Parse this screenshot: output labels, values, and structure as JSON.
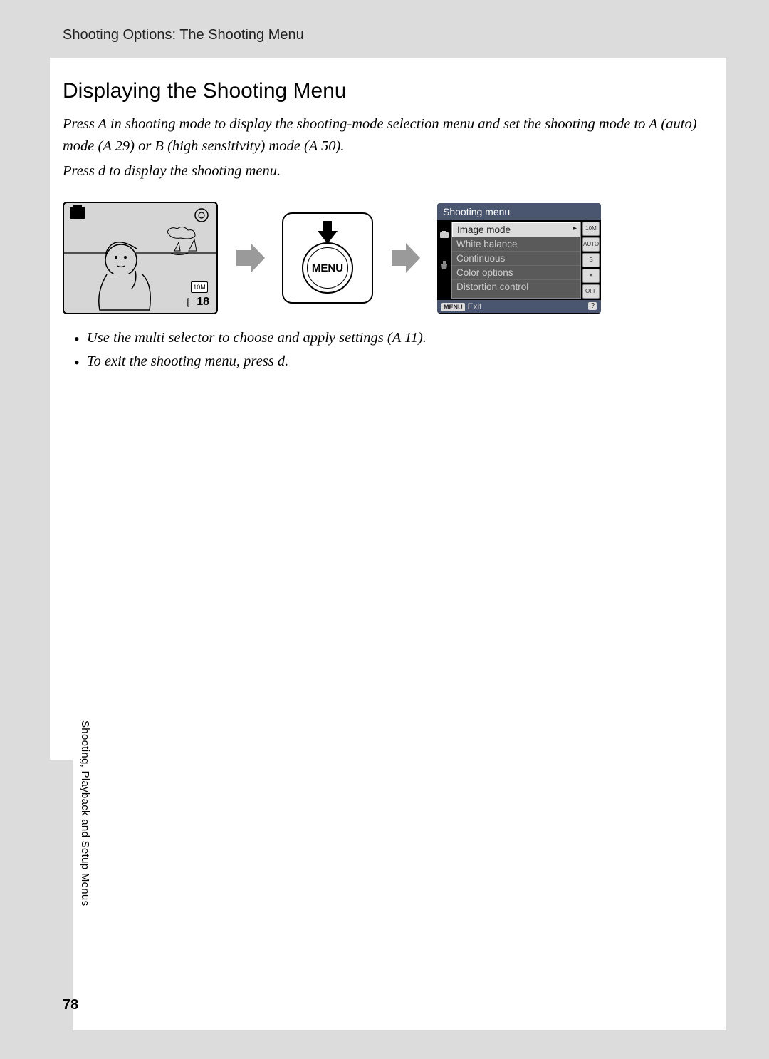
{
  "header": "Shooting Options: The Shooting Menu",
  "title": "Displaying the Shooting Menu",
  "intro": {
    "l1": "Press A in shooting mode to display the shooting-mode selection menu and set the shooting mode to A (auto) mode (A 29) or B (high sensitivity) mode (A 50).",
    "l2": "Press d to display the shooting menu."
  },
  "menu_button": "MENU",
  "shooting_menu": {
    "title": "Shooting menu",
    "items": [
      "Image mode",
      "White balance",
      "Continuous",
      "Color options",
      "Distortion control"
    ],
    "right_chips": [
      "10M",
      "AUTO",
      "S",
      "✕",
      "OFF"
    ],
    "exit": "Exit",
    "menu_tag": "MENU",
    "help": "?"
  },
  "camera_lcd": {
    "badge": "10M",
    "shots": "18",
    "left_icon_text": "[ "
  },
  "bullets": [
    "Use the multi selector to choose and apply settings (A 11).",
    "To exit the shooting menu, press d."
  ],
  "side_tab": "Shooting, Playback and Setup Menus",
  "page_number": "78"
}
